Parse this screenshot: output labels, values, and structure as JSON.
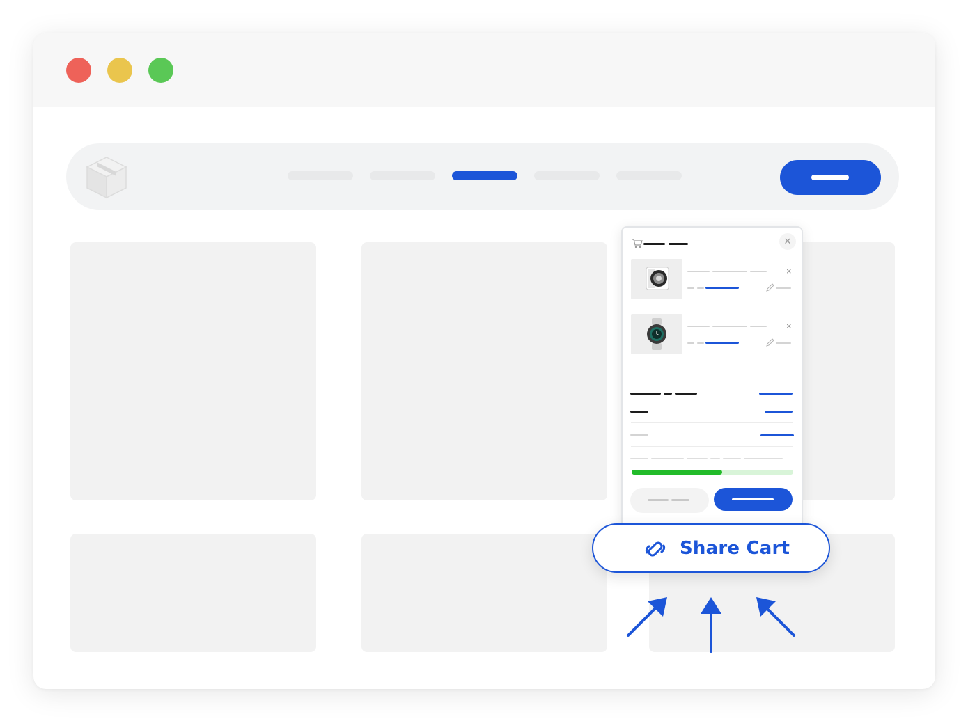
{
  "window": {
    "traffic_lights": {
      "close_color": "#ee6259",
      "minimize_color": "#eac54d",
      "maximize_color": "#5ac856"
    }
  },
  "navbar": {
    "logo_icon": "box-icon",
    "links": [
      {
        "active": false
      },
      {
        "active": false
      },
      {
        "active": true
      },
      {
        "active": false
      },
      {
        "active": false
      }
    ],
    "accent_color": "#1c55d8"
  },
  "cart": {
    "header_icon": "cart-icon",
    "close_icon": "close-icon",
    "items": [
      {
        "image_icon": "speaker-product-image",
        "remove_icon": "close-icon",
        "edit_icon": "pencil-icon"
      },
      {
        "image_icon": "watch-product-image",
        "remove_icon": "close-icon",
        "edit_icon": "pencil-icon"
      }
    ],
    "shipping_progress": 0.56,
    "progress_color": "#22bb2a"
  },
  "share": {
    "label": "Share Cart",
    "icon": "link-icon"
  },
  "arrows": {
    "icon": "arrow-up-icon",
    "count": 3
  }
}
